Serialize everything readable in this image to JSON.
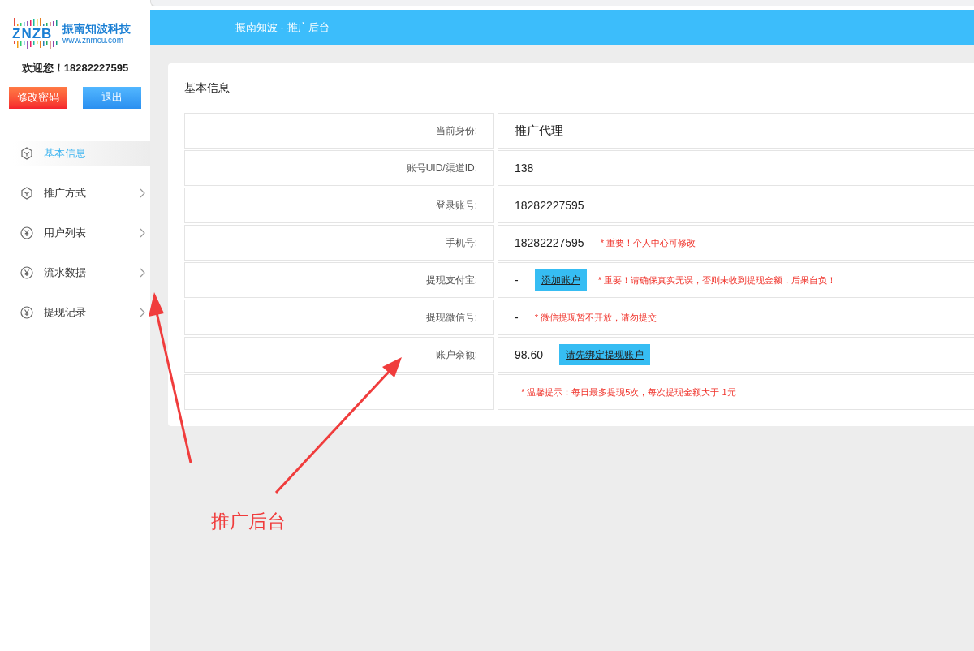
{
  "logo": {
    "mark": "ZNZB",
    "name": "振南知波科技",
    "url": "www.znmcu.com"
  },
  "welcome": "欢迎您！18282227595",
  "buttons": [
    {
      "label": "修改密码",
      "kind": "danger"
    },
    {
      "label": "退出",
      "kind": "primary"
    }
  ],
  "sidebar": {
    "items": [
      {
        "label": "基本信息",
        "selected": true,
        "has_submenu": false
      },
      {
        "label": "推广方式",
        "selected": false,
        "has_submenu": true
      },
      {
        "label": "用户列表",
        "selected": false,
        "has_submenu": true
      },
      {
        "label": "流水数据",
        "selected": false,
        "has_submenu": true
      },
      {
        "label": "提现记录",
        "selected": false,
        "has_submenu": true
      }
    ]
  },
  "header": {
    "title": "振南知波 - 推广后台"
  },
  "card": {
    "title": "基本信息",
    "rows": [
      {
        "label": "当前身份:",
        "value": "推广代理",
        "emphasis": true
      },
      {
        "label": "账号UID/渠道ID:",
        "value": "138"
      },
      {
        "label": "登录账号:",
        "value": "18282227595"
      },
      {
        "label": "手机号:",
        "value": "18282227595",
        "note": "* 重要！个人中心可修改"
      },
      {
        "label": "提现支付宝:",
        "value": "-",
        "button": "添加账户",
        "note": "* 重要！请确保真实无误，否则未收到提现金额，后果自负！"
      },
      {
        "label": "提现微信号:",
        "value": "-",
        "note": "* 微信提现暂不开放，请勿提交"
      },
      {
        "label": "账户余额:",
        "value": "98.60",
        "button": "请先绑定提现账户"
      },
      {
        "note": "* 温馨提示：每日最多提现5次，每次提现金额大于 1元"
      }
    ]
  },
  "annotation": {
    "text": "推广后台"
  }
}
